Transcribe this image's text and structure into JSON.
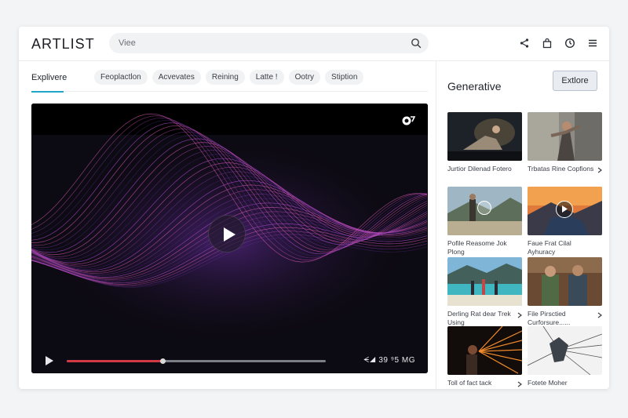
{
  "header": {
    "logo": "ARTLIST",
    "search": {
      "placeholder": "Viee"
    },
    "icons": [
      "share-icon",
      "bag-icon",
      "timer-icon",
      "menu-icon"
    ]
  },
  "tabs": {
    "active": "Explivere",
    "chips": [
      "Feoplactlon",
      "Acvevates",
      "Reining",
      "Latte !",
      "Ootry",
      "Stiption"
    ]
  },
  "player": {
    "progress_fraction": 0.37,
    "readout": "ᗕ◢  39  ⁹5  MG",
    "accent": "#d13a44"
  },
  "sidebar": {
    "title": "Generative",
    "explore_label": "Extlore",
    "items": [
      {
        "caption": "Jurtior Dilenad Fotero",
        "chevron": false
      },
      {
        "caption": "Trbatas Rine Copfions",
        "chevron": true
      },
      {
        "caption": "Pofile Reasome Jok Plong",
        "chevron": false,
        "play": true
      },
      {
        "caption": "Faue Frat Cilal Ayhuracy",
        "chevron": false,
        "play": true
      },
      {
        "caption": "Derling Rat dear Trek Using",
        "chevron": true
      },
      {
        "caption": "File Pirsctied Curforsure......",
        "chevron": true
      },
      {
        "caption": "Toll of fact tack",
        "chevron": true
      },
      {
        "caption": "Fotete Moher Sorrrices",
        "chevron": false
      }
    ]
  }
}
